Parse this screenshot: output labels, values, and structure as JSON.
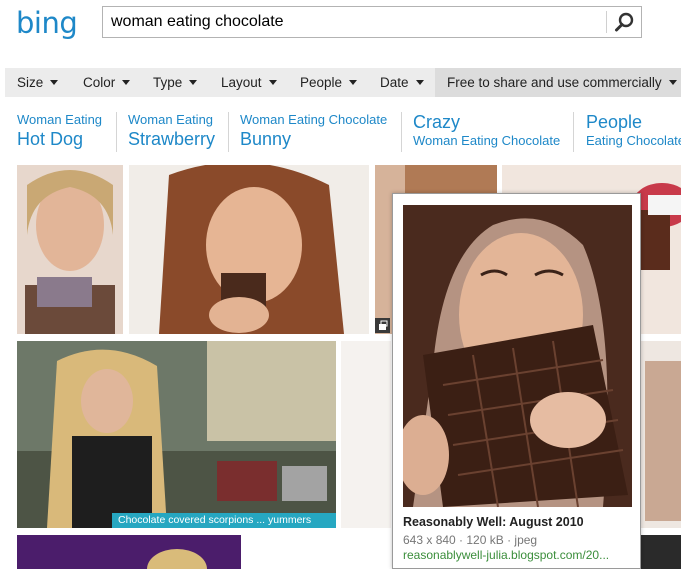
{
  "brand": {
    "logo_text": "bing"
  },
  "search": {
    "query": "woman eating chocolate"
  },
  "filters": [
    {
      "label": "Size"
    },
    {
      "label": "Color"
    },
    {
      "label": "Type"
    },
    {
      "label": "Layout"
    },
    {
      "label": "People"
    },
    {
      "label": "Date"
    },
    {
      "label": "Free to share and use commercially"
    }
  ],
  "related": [
    {
      "small": "Woman Eating",
      "big": "Hot Dog"
    },
    {
      "small": "Woman Eating",
      "big": "Strawberry"
    },
    {
      "small": "Woman Eating Chocolate",
      "big": "Bunny"
    },
    {
      "big": "Crazy",
      "small": "Woman Eating Chocolate"
    },
    {
      "big": "People",
      "small": "Eating Chocolate"
    }
  ],
  "tiles": {
    "caption": "Chocolate covered scorpions ... yummers"
  },
  "popup": {
    "title": "Reasonably Well: August 2010",
    "meta": "643 x 840 · 120 kB · jpeg",
    "url": "reasonablywell-julia.blogspot.com/20..."
  },
  "colors": {
    "accent": "#1e88c8",
    "caption_bg": "#26a7c1",
    "url_green": "#3b8e3b"
  },
  "icons": [
    "search-icon",
    "caret-down-icon",
    "expand-icon"
  ]
}
